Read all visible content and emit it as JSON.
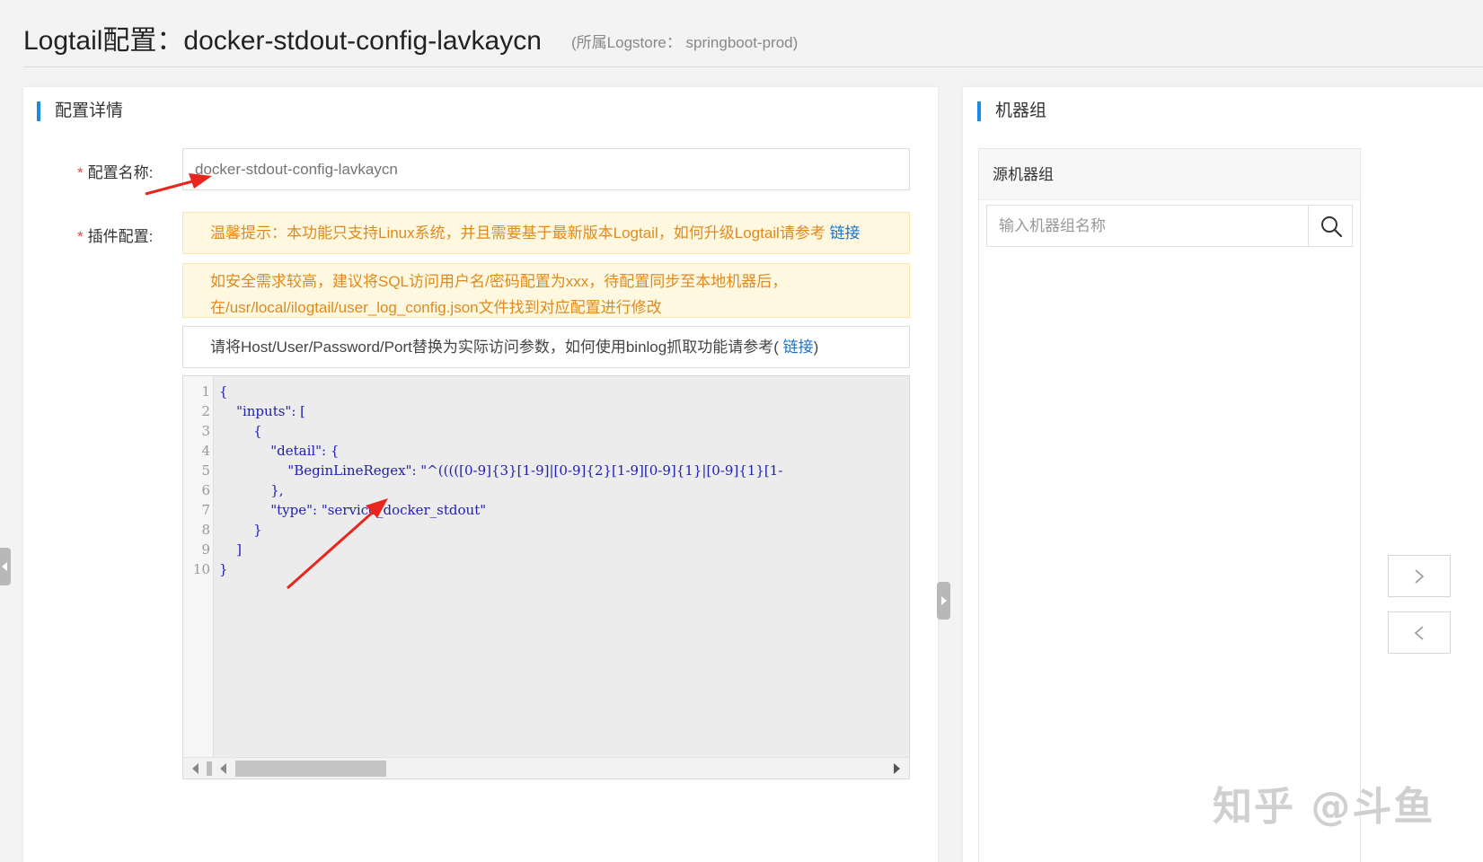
{
  "header": {
    "title": "Logtail配置：docker-stdout-config-lavkaycn",
    "subtitle": "(所属Logstore： springboot-prod)"
  },
  "config_panel": {
    "section_title": "配置详情",
    "name_label": "配置名称:",
    "name_placeholder": "docker-stdout-config-lavkaycn",
    "plugin_label": "插件配置:",
    "tip1_text": "温馨提示：本功能只支持Linux系统，并且需要基于最新版本Logtail，如何升级Logtail请参考 ",
    "tip1_link": "链接",
    "tip2_line1": "如安全需求较高，建议将SQL访问用户名/密码配置为xxx，待配置同步至本地机器后，",
    "tip2_line2": "在/usr/local/ilogtail/user_log_config.json文件找到对应配置进行修改",
    "info_text": "请将Host/User/Password/Port替换为实际访问参数，如何使用binlog抓取功能请参考( ",
    "info_link": "链接",
    "info_suffix": ")"
  },
  "code": {
    "line_numbers": [
      "1",
      "2",
      "3",
      "4",
      "5",
      "6",
      "7",
      "8",
      "9",
      "10"
    ],
    "lines": [
      "{",
      "    \"inputs\": [",
      "        {",
      "            \"detail\": {",
      "                \"BeginLineRegex\": \"^(((([0-9]{3}[1-9]|[0-9]{2}[1-9][0-9]{1}|[0-9]{1}[1-",
      "            },",
      "            \"type\": \"service_docker_stdout\"",
      "        }",
      "    ]",
      "}"
    ]
  },
  "machine_panel": {
    "section_title": "机器组",
    "source_group_title": "源机器组",
    "search_placeholder": "输入机器组名称"
  },
  "watermark": "知乎 @斗鱼",
  "colors": {
    "accent": "#1a8be8",
    "warning_text": "#e08a1e",
    "warning_bg": "#fff8e0",
    "link": "#1a73c8",
    "annotation": "#e8261f"
  }
}
